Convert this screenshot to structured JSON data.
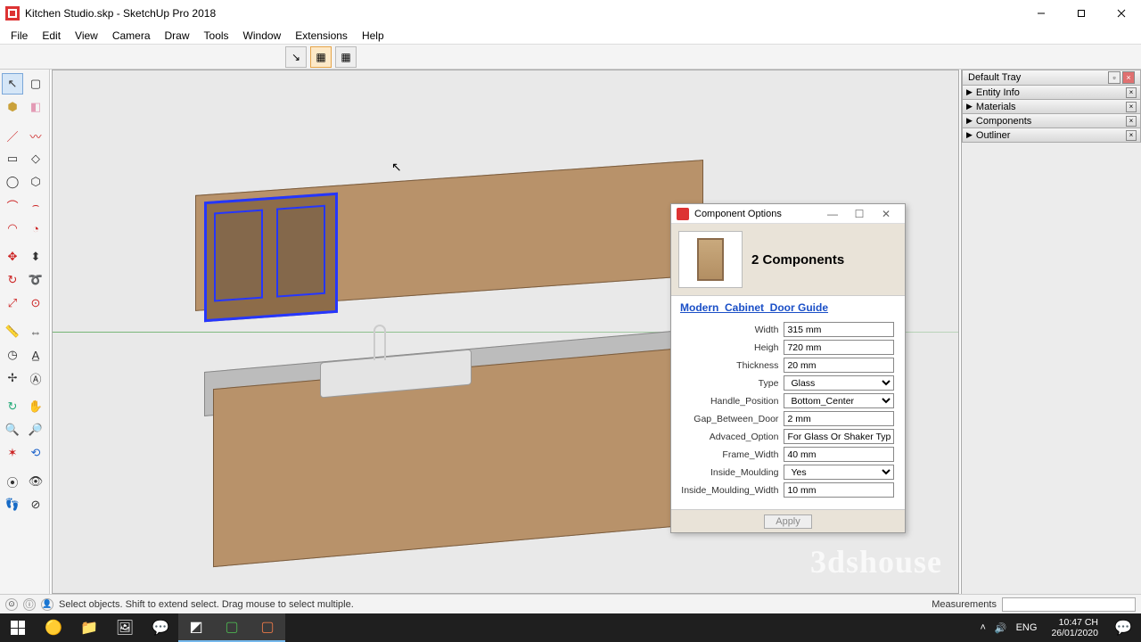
{
  "title": "Kitchen Studio.skp - SketchUp Pro 2018",
  "menu": [
    "File",
    "Edit",
    "View",
    "Camera",
    "Draw",
    "Tools",
    "Window",
    "Extensions",
    "Help"
  ],
  "tray": {
    "title": "Default Tray",
    "panels": [
      "Entity Info",
      "Materials",
      "Components",
      "Outliner"
    ]
  },
  "dialog": {
    "title": "Component Options",
    "heading": "2 Components",
    "link": "Modern_Cabinet_Door Guide",
    "fields": [
      {
        "label": "Width",
        "value": "315 mm",
        "type": "text"
      },
      {
        "label": "Heigh",
        "value": "720 mm",
        "type": "text"
      },
      {
        "label": "Thickness",
        "value": "20 mm",
        "type": "text"
      },
      {
        "label": "Type",
        "value": "Glass",
        "type": "select"
      },
      {
        "label": "Handle_Position",
        "value": "Bottom_Center",
        "type": "select"
      },
      {
        "label": "Gap_Between_Door",
        "value": "2 mm",
        "type": "text"
      },
      {
        "label": "Advaced_Option",
        "value": "For Glass Or Shaker Type",
        "type": "text"
      },
      {
        "label": "Frame_Width",
        "value": "40 mm",
        "type": "text"
      },
      {
        "label": "Inside_Moulding",
        "value": "Yes",
        "type": "select"
      },
      {
        "label": "Inside_Moulding_Width",
        "value": "10 mm",
        "type": "text"
      }
    ],
    "apply": "Apply"
  },
  "status": {
    "hint": "Select objects. Shift to extend select. Drag mouse to select multiple.",
    "measure_label": "Measurements"
  },
  "watermark": "3dshouse",
  "taskbar": {
    "lang": "ENG",
    "time": "10:47 CH",
    "date": "26/01/2020"
  }
}
